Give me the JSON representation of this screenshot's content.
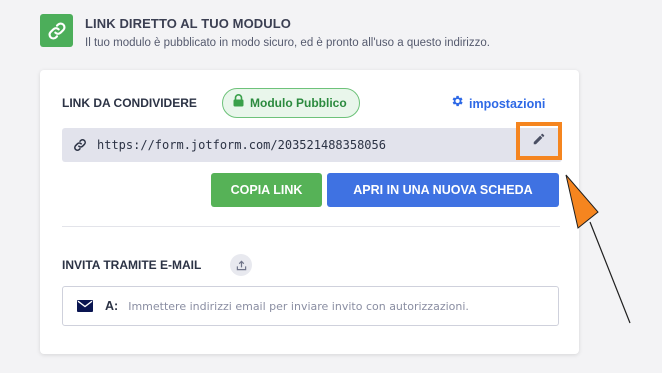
{
  "header": {
    "title": "LINK DIRETTO AL TUO MODULO",
    "description": "Il tuo modulo è pubblicato in modo sicuro, ed è pronto all'uso a questo indirizzo."
  },
  "share": {
    "label": "LINK DA CONDIVIDERE",
    "badge": "Modulo Pubblico",
    "settings_label": "impostazioni",
    "url": "https://form.jotform.com/203521488358056"
  },
  "buttons": {
    "copy": "COPIA LINK",
    "open": "APRI IN UNA NUOVA SCHEDA"
  },
  "invite": {
    "label": "INVITA TRAMITE E-MAIL",
    "prefix": "A:",
    "placeholder": "Immettere indirizzi email per inviare invito con autorizzazioni."
  },
  "colors": {
    "brand_green": "#4cae5a",
    "accent_blue": "#3f72e2",
    "highlight_orange": "#f5851f"
  },
  "icons": [
    "link-icon",
    "lock-icon",
    "gear-icon",
    "chain-link-icon",
    "pencil-icon",
    "share-icon",
    "envelope-icon",
    "arrow-annotation"
  ]
}
